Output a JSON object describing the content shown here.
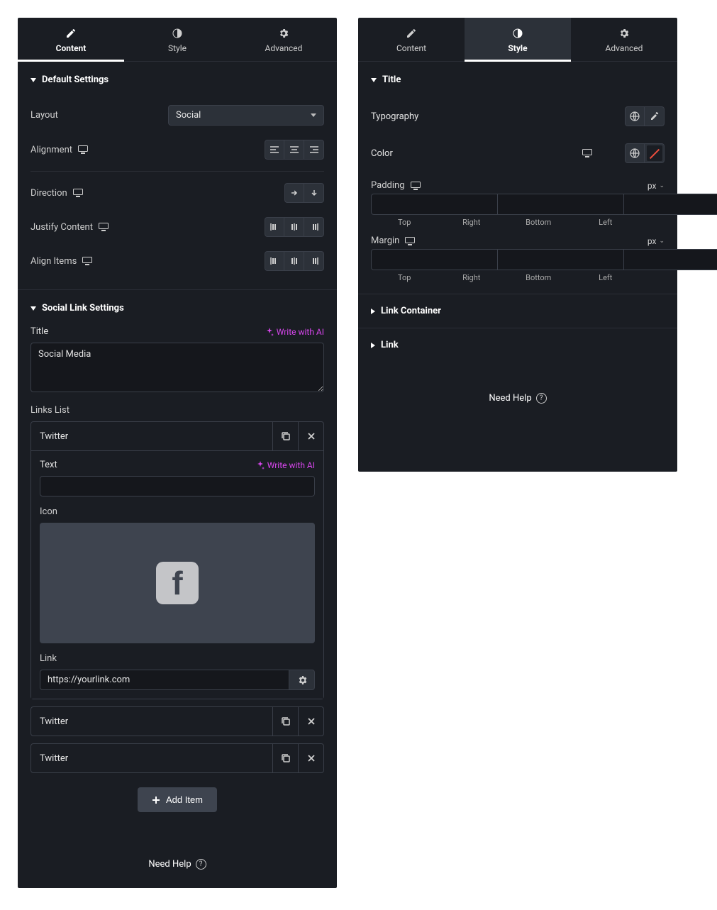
{
  "tabs": {
    "content": "Content",
    "style": "Style",
    "advanced": "Advanced"
  },
  "content_panel": {
    "default_settings": {
      "title": "Default Settings",
      "layout_label": "Layout",
      "layout_value": "Social",
      "alignment_label": "Alignment",
      "direction_label": "Direction",
      "justify_label": "Justify Content",
      "align_items_label": "Align Items"
    },
    "social_link": {
      "title": "Social Link Settings",
      "title_label": "Title",
      "ai_text": "Write with AI",
      "title_value": "Social Media",
      "links_list_label": "Links List",
      "items": [
        {
          "label": "Twitter",
          "expanded": true,
          "text_label": "Text",
          "text_value": "",
          "icon_label": "Icon",
          "link_label": "Link",
          "link_value": "https://yourlink.com"
        },
        {
          "label": "Twitter",
          "expanded": false
        },
        {
          "label": "Twitter",
          "expanded": false
        }
      ],
      "add_item": "Add Item"
    },
    "need_help": "Need Help"
  },
  "style_panel": {
    "title_section": {
      "title": "Title",
      "typography_label": "Typography",
      "color_label": "Color",
      "padding_label": "Padding",
      "margin_label": "Margin",
      "unit": "px",
      "sides": {
        "top": "Top",
        "right": "Right",
        "bottom": "Bottom",
        "left": "Left"
      }
    },
    "link_container": "Link Container",
    "link": "Link",
    "need_help": "Need Help"
  }
}
